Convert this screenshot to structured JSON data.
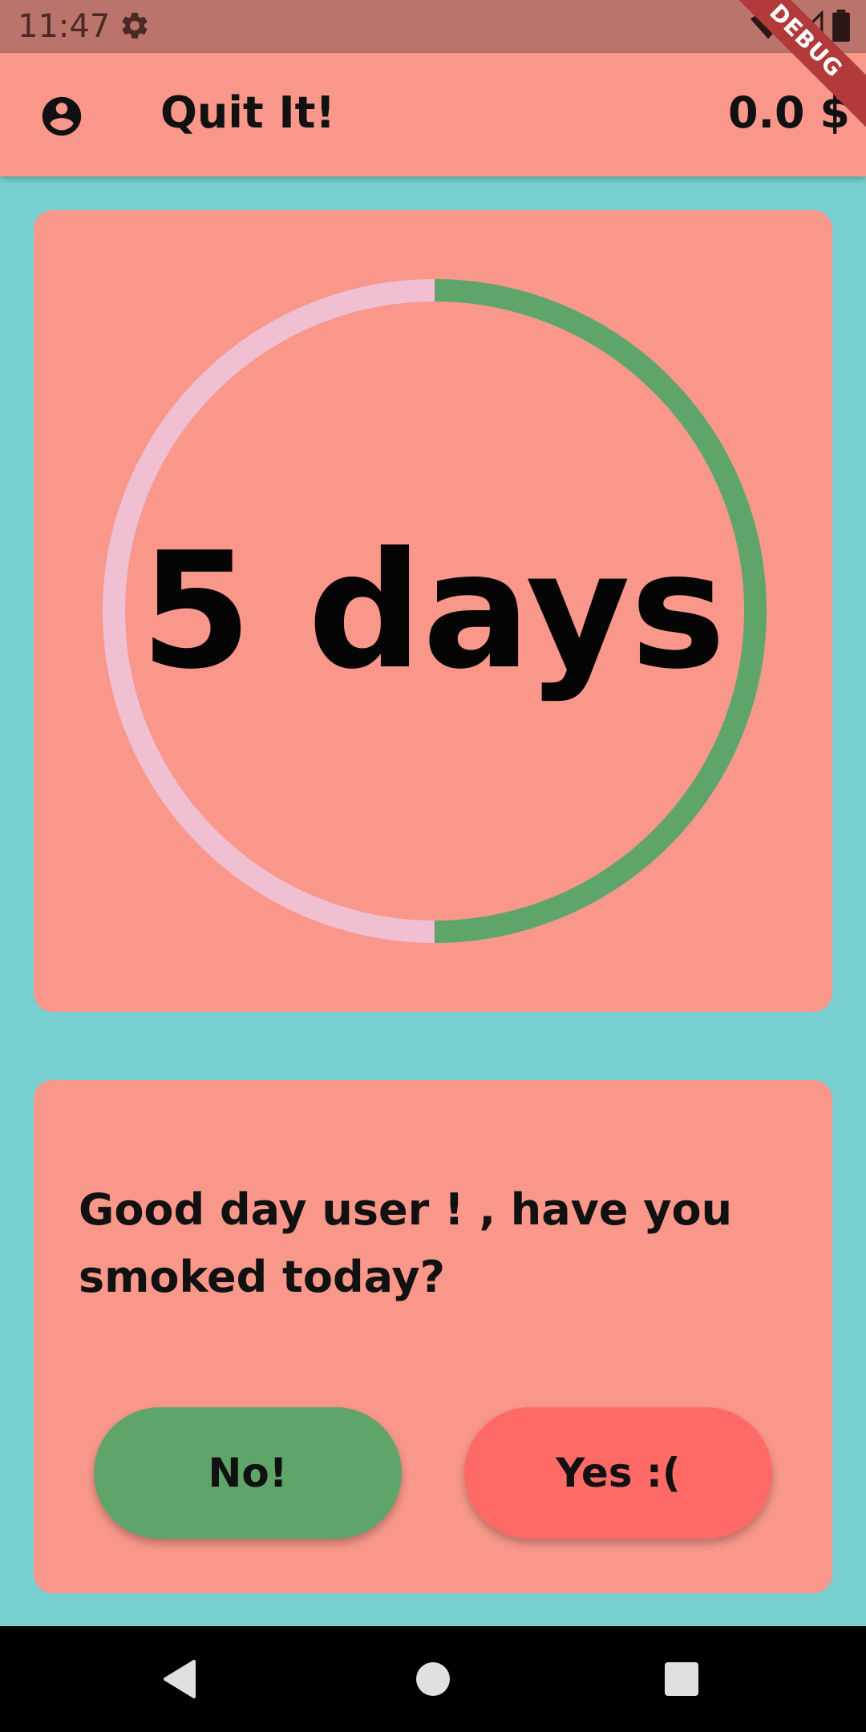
{
  "status_bar": {
    "time": "11:47",
    "settings_icon": "gear-icon",
    "wifi_icon": "wifi-icon",
    "signal_icon": "signal-icon",
    "battery_icon": "battery-icon",
    "background_color": "#BB746B"
  },
  "debug_banner": "DEBUG",
  "app_bar": {
    "title": "Quit It!",
    "balance": "0.0 $",
    "profile_icon": "account-circle-icon",
    "background_color": "#F8978A"
  },
  "progress_card": {
    "label": "5 days",
    "progress_fraction": 0.5,
    "progress_color": "#5FA56A",
    "track_color": "#F0C0D2"
  },
  "question_card": {
    "prompt": "Good day user ! , have you smoked today?",
    "no_label": "No!",
    "yes_label": "Yes :(",
    "no_color": "#5FA56A",
    "yes_color": "#FF6A67"
  },
  "nav_bar": {
    "back_icon": "back-triangle-icon",
    "home_icon": "home-circle-icon",
    "recents_icon": "recents-square-icon"
  },
  "colors": {
    "background": "#77CFCF",
    "card": "#F8978A"
  }
}
